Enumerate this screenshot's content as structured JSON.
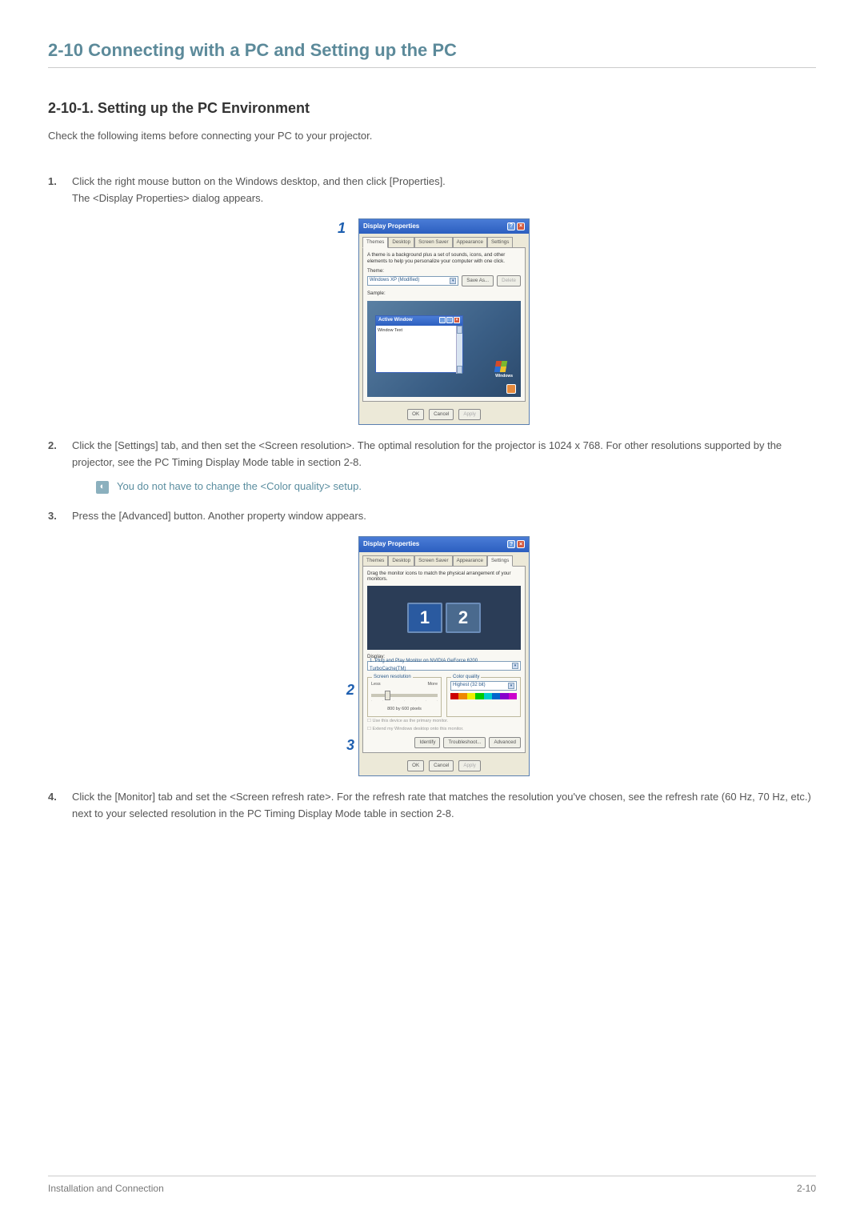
{
  "section_title": "2-10  Connecting with a PC and Setting up the PC",
  "subsection_title": "2-10-1. Setting up the PC Environment",
  "intro": "Check the following items before connecting your PC to your projector.",
  "steps": [
    {
      "text": "Click the right mouse button on the Windows desktop, and then click [Properties].",
      "sub": "The <Display Properties> dialog appears."
    },
    {
      "text": "Click the [Settings] tab, and then set the <Screen resolution>. The optimal resolution for the projector is 1024 x 768. For other resolutions supported by the projector, see the PC Timing Display Mode table in section 2-8."
    },
    {
      "text": "Press the [Advanced] button. Another property window appears."
    },
    {
      "text": "Click the [Monitor] tab and set the <Screen refresh rate>. For the refresh rate that matches the resolution you've chosen, see the refresh rate (60 Hz, 70 Hz, etc.) next to your selected resolution in the PC Timing Display Mode table in section 2-8."
    }
  ],
  "note": "You do not have to change the <Color quality> setup.",
  "dlg1": {
    "title": "Display Properties",
    "tabs": [
      "Themes",
      "Desktop",
      "Screen Saver",
      "Appearance",
      "Settings"
    ],
    "active_tab": "Themes",
    "desc": "A theme is a background plus a set of sounds, icons, and other elements to help you personalize your computer with one click.",
    "theme_label": "Theme:",
    "theme_value": "Windows XP (Modified)",
    "save_as": "Save As...",
    "delete": "Delete",
    "sample_label": "Sample:",
    "active_window": "Active Window",
    "window_text": "Window Text",
    "windows_brand": "Windows",
    "ok": "OK",
    "cancel": "Cancel",
    "apply": "Apply",
    "callout": "1"
  },
  "dlg2": {
    "title": "Display Properties",
    "tabs": [
      "Themes",
      "Desktop",
      "Screen Saver",
      "Appearance",
      "Settings"
    ],
    "active_tab": "Settings",
    "desc": "Drag the monitor icons to match the physical arrangement of your monitors.",
    "mon1": "1",
    "mon2": "2",
    "display_label": "Display:",
    "display_value": "1. Plug and Play Monitor on NVIDIA GeForce 6200 TurboCache(TM)",
    "res_legend": "Screen resolution",
    "less": "Less",
    "more": "More",
    "res_value": "800 by 600 pixels",
    "cq_legend": "Color quality",
    "cq_value": "Highest (32 bit)",
    "chk1": "Use this device as the primary monitor.",
    "chk2": "Extend my Windows desktop onto this monitor.",
    "identify": "Identify",
    "troubleshoot": "Troubleshoot...",
    "advanced": "Advanced",
    "ok": "OK",
    "cancel": "Cancel",
    "apply": "Apply",
    "callout2": "2",
    "callout3": "3"
  },
  "footer_left": "Installation and Connection",
  "footer_right": "2-10"
}
